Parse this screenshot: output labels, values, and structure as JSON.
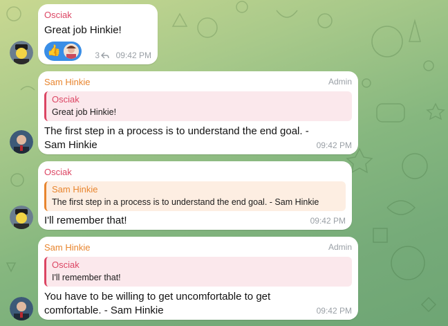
{
  "messages": [
    {
      "sender": "Osciak",
      "text": "Great job Hinkie!",
      "reaction_emoji": "👍",
      "reply_count": "3",
      "time": "09:42 PM"
    },
    {
      "sender": "Sam Hinkie",
      "role": "Admin",
      "quote_sender": "Osciak",
      "quote_text": "Great job Hinkie!",
      "text": "The first step in a process is to understand the end goal. - Sam Hinkie",
      "time": "09:42 PM"
    },
    {
      "sender": "Osciak",
      "quote_sender": "Sam Hinkie",
      "quote_text": "The first step in a process is to understand the end goal. - Sam Hinkie",
      "text": "I'll remember that!",
      "time": "09:42 PM"
    },
    {
      "sender": "Sam Hinkie",
      "role": "Admin",
      "quote_sender": "Osciak",
      "quote_text": "I'll remember that!",
      "text": "You have to be willing to get uncomfortable to get comfortable. - Sam Hinkie",
      "time": "09:42 PM"
    }
  ],
  "colors": {
    "osciak_name": "#dc4563",
    "hinkie_name": "#e8852e",
    "reaction_bg": "#3a8ee6"
  }
}
